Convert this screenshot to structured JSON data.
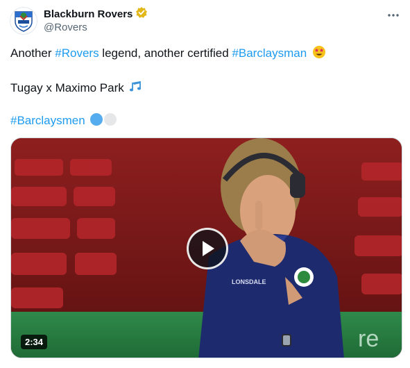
{
  "author": {
    "display_name": "Blackburn Rovers",
    "handle": "@Rovers",
    "verified_badge_color": "#e2b719"
  },
  "tweet": {
    "line1": {
      "prefix": "Another ",
      "hashtag1": "#Rovers",
      "middle": " legend, another certified ",
      "hashtag2": "#Barclaysman",
      "emoji": "star-struck"
    },
    "line2": {
      "text": "Tugay x Maximo Park",
      "emoji": "musical-notes"
    },
    "line3": {
      "hashtag": "#Barclaysmen",
      "emoji": "blue-and-white-circles"
    }
  },
  "video": {
    "duration": "2:34"
  },
  "colors": {
    "link": "#1d9bf0",
    "text": "#0f1419",
    "secondary": "#536471",
    "club_blue": "#2a6fcf"
  }
}
